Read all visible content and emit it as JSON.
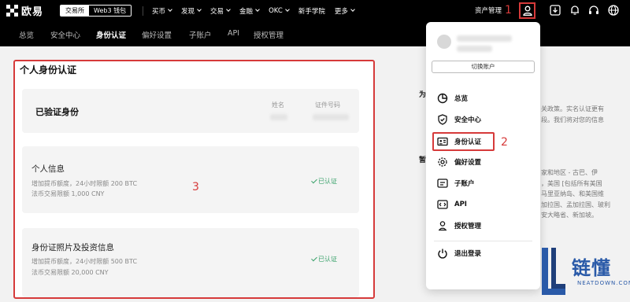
{
  "topbar": {
    "logo_text": "欧易",
    "modes": [
      {
        "label": "交易所",
        "active": true
      },
      {
        "label": "Web3 钱包",
        "active": false
      }
    ],
    "nav": [
      {
        "label": "买币",
        "dropdown": true
      },
      {
        "label": "发现",
        "dropdown": true
      },
      {
        "label": "交易",
        "dropdown": true
      },
      {
        "label": "金融",
        "dropdown": true
      },
      {
        "label": "OKC",
        "dropdown": true
      },
      {
        "label": "新手学院",
        "dropdown": false
      },
      {
        "label": "更多",
        "dropdown": true
      }
    ],
    "asset_mgmt": "资产管理",
    "step1": "1",
    "icons": [
      "user-icon",
      "download-icon",
      "bell-icon",
      "headset-icon",
      "globe-icon"
    ]
  },
  "subnav": {
    "tabs": [
      {
        "label": "总览",
        "active": false
      },
      {
        "label": "安全中心",
        "active": false
      },
      {
        "label": "身份认证",
        "active": true
      },
      {
        "label": "偏好设置",
        "active": false
      },
      {
        "label": "子账户",
        "active": false
      },
      {
        "label": "API",
        "active": false
      },
      {
        "label": "授权管理",
        "active": false
      }
    ]
  },
  "main": {
    "title": "个人身份认证",
    "verified": {
      "title": "已验证身份",
      "col_name": "姓名",
      "col_id": "证件号码"
    },
    "cards": [
      {
        "title": "个人信息",
        "desc1": "增加提币额度，24小时限额 200 BTC",
        "desc2": "法币交易限额 1,000 CNY",
        "badge": "已认证"
      },
      {
        "title": "身份证照片及投资信息",
        "desc1": "增加提币额度，24小时限额 500 BTC",
        "desc2": "法币交易限额 20,000 CNY",
        "badge": "已认证"
      }
    ],
    "step3": "3"
  },
  "side": {
    "heading1": "为",
    "lines1": [
      "关政策。实名认证更有",
      "段。我们将对您的信息"
    ],
    "heading2": "暂",
    "lines2": [
      "家和地区 - 古巴、伊",
      "，美国 [包括所有美国",
      "马里亚纳岛、和美国维",
      "加拉国、孟加拉国、玻利",
      "安大略省、新加坡。"
    ]
  },
  "dropdown": {
    "switch_account": "切换账户",
    "items": [
      {
        "label": "总览",
        "icon": "pie-chart-icon"
      },
      {
        "label": "安全中心",
        "icon": "shield-icon"
      },
      {
        "label": "身份认证",
        "icon": "id-card-icon"
      },
      {
        "label": "偏好设置",
        "icon": "gear-icon"
      },
      {
        "label": "子账户",
        "icon": "sub-account-icon"
      },
      {
        "label": "API",
        "icon": "api-icon"
      },
      {
        "label": "授权管理",
        "icon": "authorization-icon"
      },
      {
        "label": "退出登录",
        "icon": "power-icon"
      }
    ],
    "step2": "2"
  },
  "watermark": {
    "text": "链懂",
    "sub": "NEATDOWN.COM"
  },
  "colors": {
    "accent_red": "#d63a3a",
    "verified_green": "#39a16a",
    "brand_blue": "#2a5aa8"
  }
}
